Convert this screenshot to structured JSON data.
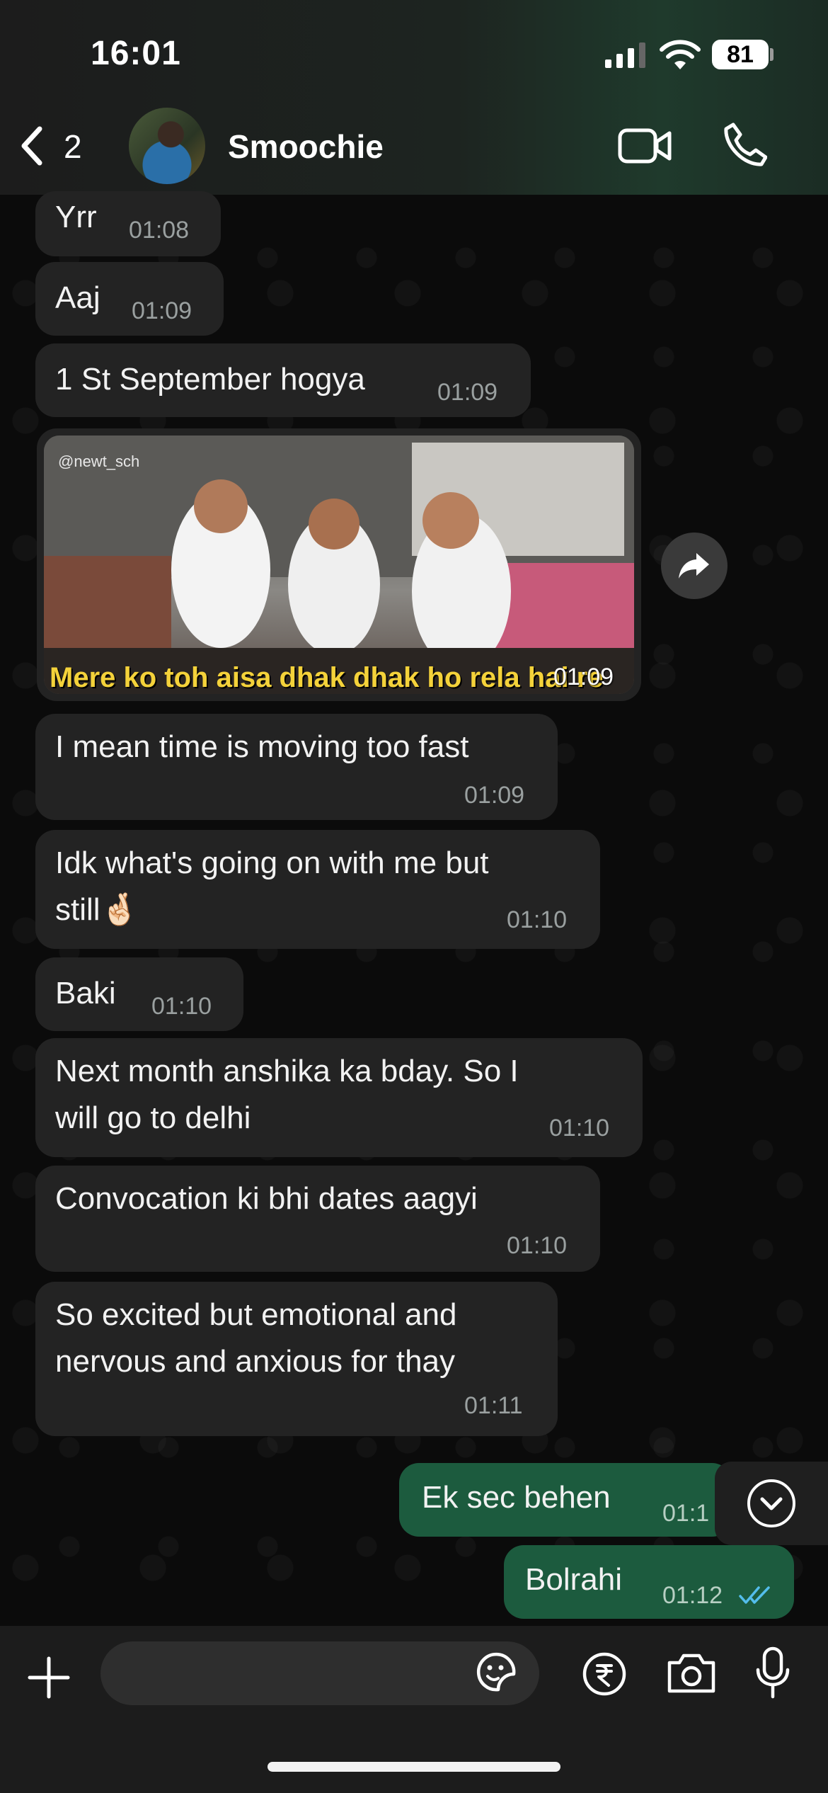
{
  "status_bar": {
    "time": "16:01",
    "battery": "81"
  },
  "header": {
    "back_count": "2",
    "contact_name": "Smoochie"
  },
  "messages": [
    {
      "text": "Yrr",
      "time": "01:08"
    },
    {
      "text": "Aaj",
      "time": "01:09"
    },
    {
      "text": "1 St September hogya",
      "time": "01:09"
    },
    {
      "text": "I mean time is moving too fast",
      "time": "01:09"
    },
    {
      "line1": "Idk what's going on with me but",
      "line2": "still🤞🏻",
      "time": "01:10"
    },
    {
      "text": "Baki",
      "time": "01:10"
    },
    {
      "line1": "Next month anshika ka bday. So I",
      "line2": "will go to delhi",
      "time": "01:10"
    },
    {
      "text": "Convocation ki bhi dates aagyi",
      "time": "01:10"
    },
    {
      "line1": "So excited but emotional and",
      "line2": "nervous and anxious for thay",
      "time": "01:11"
    }
  ],
  "media": {
    "watermark": "@newt_sch",
    "caption": "Mere ko toh aisa dhak dhak ho rela hai re",
    "time": "01:09"
  },
  "outgoing": [
    {
      "text": "Ek sec behen",
      "time": "01:1"
    },
    {
      "text": "Bolrahi",
      "time": "01:12",
      "status": "read"
    }
  ],
  "input": {
    "placeholder": ""
  },
  "icons": {
    "back": "chevron-left-icon",
    "video": "video-camera-icon",
    "phone": "phone-icon",
    "forward": "forward-arrow-icon",
    "scroll": "chevron-down-circle-icon",
    "plus": "plus-icon",
    "sticker": "sticker-icon",
    "rupee": "rupee-payment-icon",
    "camera": "camera-icon",
    "mic": "microphone-icon"
  },
  "colors": {
    "incoming_bubble": "#232323",
    "outgoing_bubble": "#1c5b3e",
    "read_ticks": "#53bdeb"
  }
}
